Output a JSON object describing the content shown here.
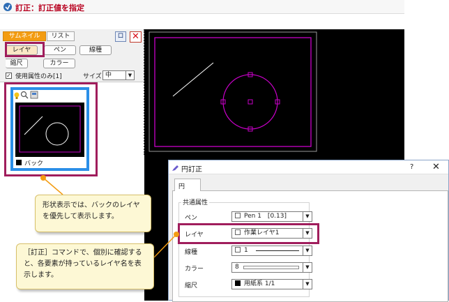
{
  "title": "訂正：訂正値を指定",
  "panel": {
    "tabs": [
      "サムネイル",
      "リスト"
    ],
    "pin_label": "ロ",
    "close_label": "✕",
    "filter_buttons": {
      "layer": "レイヤ",
      "pen": "ペン",
      "linetype": "線種",
      "scale": "縮尺",
      "color": "カラー"
    },
    "checkbox_label": "使用属性のみ[1]",
    "checkbox_checked": true,
    "size_label": "サイズ",
    "size_value": "中"
  },
  "thumbnail": {
    "name": "バック",
    "frame_color": "#2b8fe8"
  },
  "dialog": {
    "title": "円訂正",
    "help": "?",
    "close": "✕",
    "tab": "円",
    "group": "共通属性",
    "rows": [
      {
        "label": "ペン",
        "value": "Pen 1　[0.13]",
        "chip": "white"
      },
      {
        "label": "レイヤ",
        "value": "作業レイヤ1",
        "chip": "white"
      },
      {
        "label": "線種",
        "value": "1",
        "chip": "white",
        "line": true
      },
      {
        "label": "カラー",
        "value": "8",
        "chip": "none",
        "bar": true
      },
      {
        "label": "縮尺",
        "value": "用紙系 1/1",
        "chip": "black"
      }
    ]
  },
  "callouts": {
    "thumbnail": "形状表示では、バックのレイヤを優先して表示します。",
    "dialog": "［訂正］コマンドで、個別に確認すると、各要素が持っているレイヤ名を表示します。"
  },
  "colors": {
    "accent": "#f39c12",
    "highlight": "#a01d5c",
    "magenta": "#c800c8",
    "title_red": "#b8001f"
  }
}
